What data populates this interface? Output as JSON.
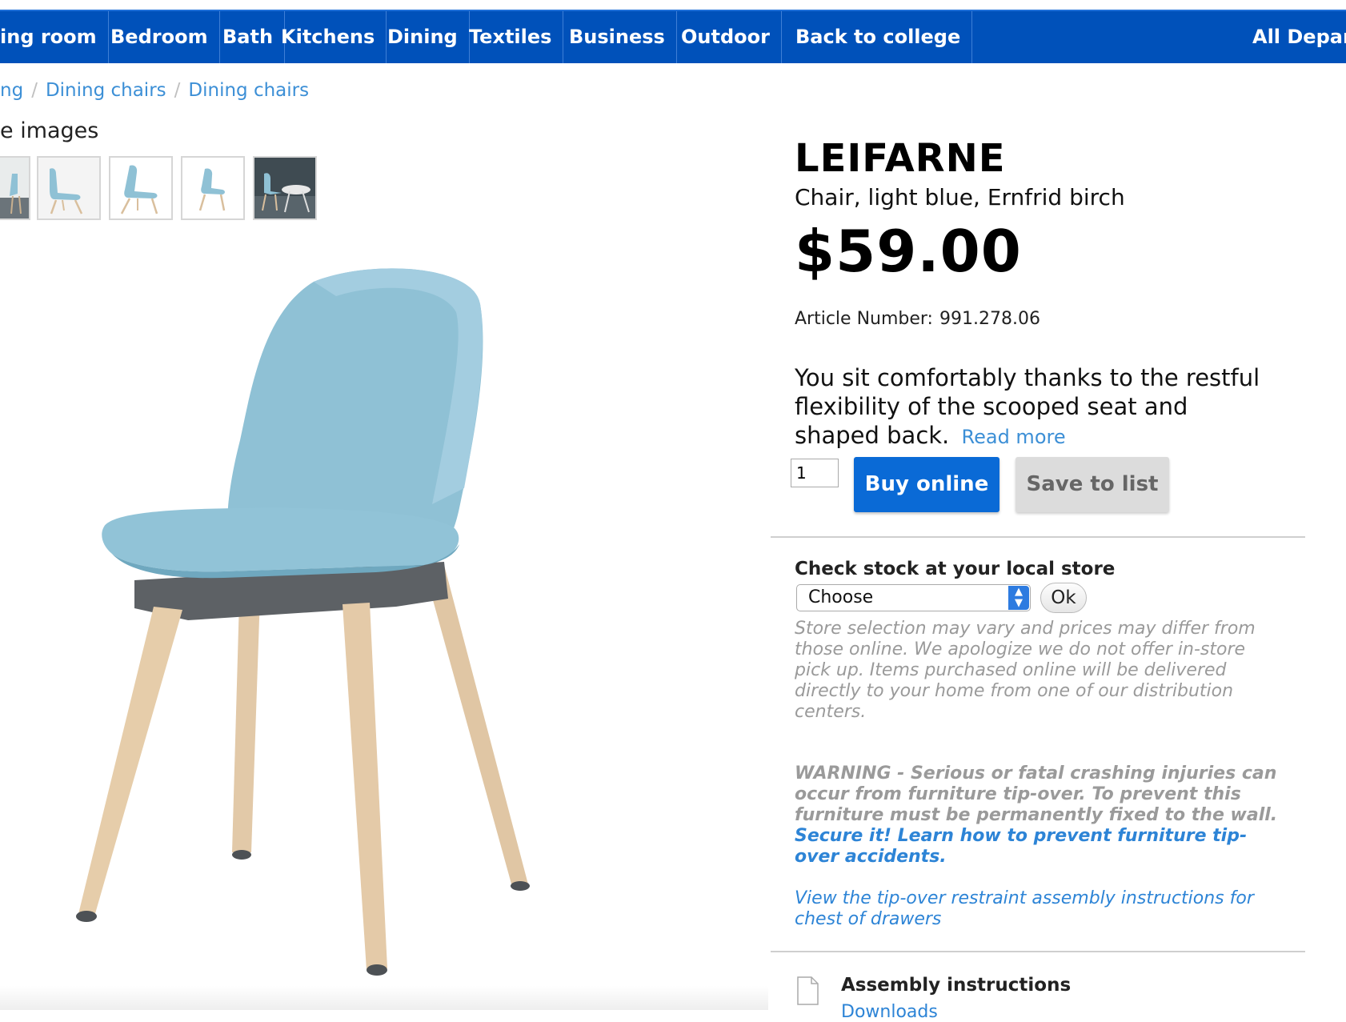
{
  "nav": {
    "items": [
      {
        "label": "ing room"
      },
      {
        "label": "Bedroom"
      },
      {
        "label": "Bath"
      },
      {
        "label": "Kitchens"
      },
      {
        "label": "Dining"
      },
      {
        "label": "Textiles"
      },
      {
        "label": "Business"
      },
      {
        "label": "Outdoor"
      },
      {
        "label": "Back to college"
      },
      {
        "label": "All Depar"
      }
    ],
    "background": "#0051ba"
  },
  "breadcrumb": {
    "items": [
      "ng",
      "Dining chairs",
      "Dining chairs"
    ],
    "separator": "/"
  },
  "gallery": {
    "heading": "e images",
    "thumb_count": 5
  },
  "product": {
    "name": "LEIFARNE",
    "description": "Chair, light blue, Ernfrid birch",
    "price": "$59.00",
    "article_label": "Article Number:",
    "article_number": "991.278.06",
    "blurb": "You sit comfortably thanks to the restful flexibility of the scooped seat and shaped back.",
    "read_more": "Read more",
    "quantity": "1",
    "buy_label": "Buy online",
    "save_label": "Save to list",
    "accent_color": "#0a6ad6"
  },
  "stock": {
    "title": "Check stock at your local store",
    "select_value": "Choose",
    "ok_label": "Ok",
    "note": "Store selection may vary and prices may differ from those online. We apologize we do not offer in-store pick up. Items purchased online will be delivered directly to your home from one of our distribution centers."
  },
  "warning": {
    "text": "WARNING - Serious or fatal crashing injuries can occur from furniture tip-over. To prevent this furniture must be permanently fixed to the wall.",
    "link": "Secure it! Learn how to prevent furniture tip-over accidents.",
    "assembly_link": "View the tip-over restraint assembly instructions for chest of drawers"
  },
  "assembly": {
    "title": "Assembly instructions",
    "downloads": "Downloads"
  },
  "chair_colors": {
    "seat": "#8fc1d5",
    "frame": "#5d6165",
    "legs": "#e2c9a8"
  }
}
